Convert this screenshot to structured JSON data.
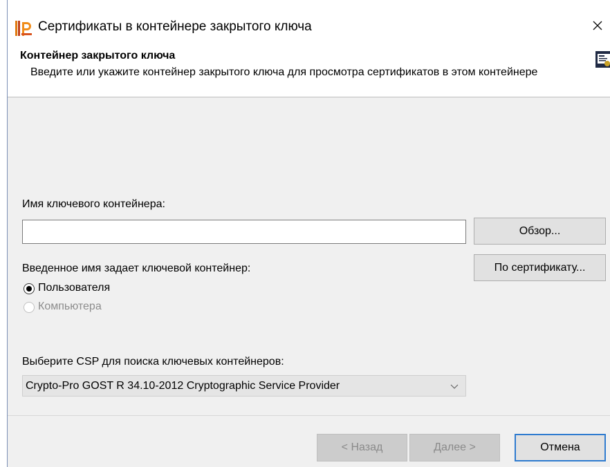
{
  "window": {
    "title": "Сертификаты в контейнере закрытого ключа",
    "icon": "cryptopro-logo-icon",
    "close_icon": "close-icon"
  },
  "header": {
    "title": "Контейнер закрытого ключа",
    "description": "Введите или укажите контейнер закрытого ключа для просмотра сертификатов в этом контейнере",
    "icon": "certificate-icon"
  },
  "container": {
    "label": "Имя ключевого контейнера:",
    "value": "",
    "browse_label": "Обзор...",
    "by_certificate_label": "По сертификату..."
  },
  "scope": {
    "label": "Введенное имя задает ключевой контейнер:",
    "options": [
      {
        "label": "Пользователя",
        "selected": true,
        "enabled": true
      },
      {
        "label": "Компьютера",
        "selected": false,
        "enabled": false
      }
    ]
  },
  "csp": {
    "label": "Выберите CSP для поиска ключевых контейнеров:",
    "selected": "Crypto-Pro GOST R 34.10-2012 Cryptographic Service Provider"
  },
  "footer": {
    "back_label": "< Назад",
    "next_label": "Далее >",
    "cancel_label": "Отмена"
  },
  "colors": {
    "accent": "#2e7bcf",
    "window_bg": "#f0f0f0",
    "button_bg": "#e1e1e1",
    "disabled_text": "#8a8a8a"
  }
}
